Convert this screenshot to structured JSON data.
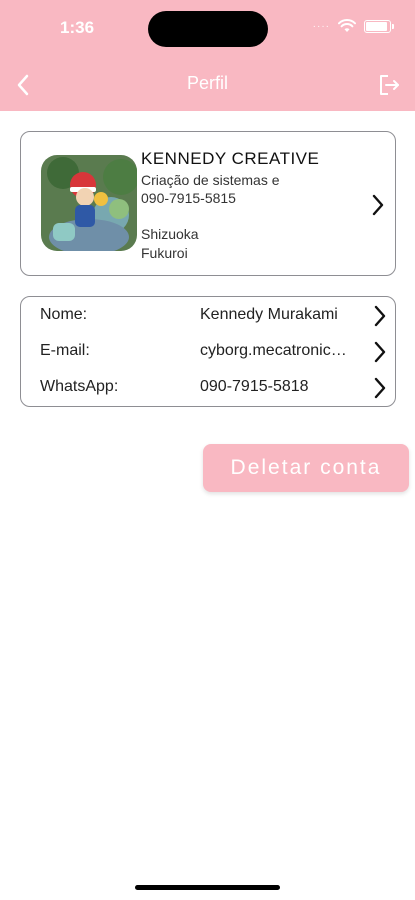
{
  "status_bar": {
    "time": "1:36",
    "signal_dots": "····"
  },
  "nav": {
    "title": "Perfil",
    "back_icon": "chevron-left-icon",
    "logout_icon": "logout-icon"
  },
  "profile": {
    "name": "KENNEDY CREATIVE",
    "description": "Criação de sistemas e",
    "phone": "090-7915-5815",
    "state": "Shizuoka",
    "city": "Fukuroi"
  },
  "info_rows": [
    {
      "label": "Nome:",
      "value": "Kennedy Murakami"
    },
    {
      "label": "E-mail:",
      "value": "cyborg.mecatronica@gmail.com"
    },
    {
      "label": "WhatsApp:",
      "value": "090-7915-5818"
    }
  ],
  "delete_button": {
    "label": "Deletar conta"
  },
  "colors": {
    "accent": "#f9b8c2",
    "border": "#8e8e93",
    "text": "#222222"
  }
}
